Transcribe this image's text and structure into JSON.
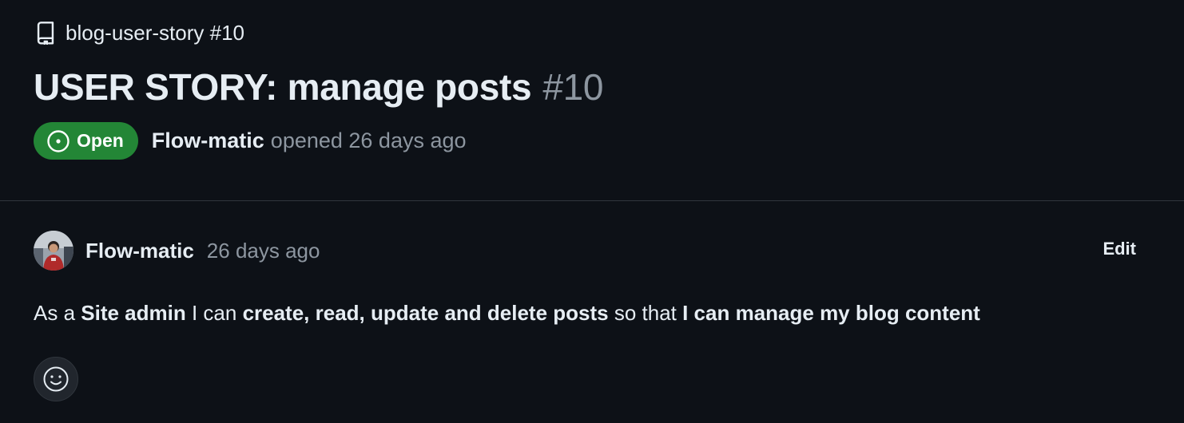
{
  "breadcrumb": {
    "icon": "repo-icon",
    "label": "blog-user-story #10"
  },
  "issue": {
    "title": "USER STORY: manage posts",
    "number": "#10",
    "state": {
      "label": "Open",
      "icon": "issue-opened-icon",
      "color": "#238636"
    },
    "author": "Flow-matic",
    "opened_text": "opened 26 days ago"
  },
  "comment": {
    "author": "Flow-matic",
    "time": "26 days ago",
    "edit_label": "Edit",
    "body": [
      {
        "text": "As a ",
        "bold": false
      },
      {
        "text": "Site admin",
        "bold": true
      },
      {
        "text": " I can ",
        "bold": false
      },
      {
        "text": "create, read, update and delete posts",
        "bold": true
      },
      {
        "text": " so that ",
        "bold": false
      },
      {
        "text": "I can manage my blog content",
        "bold": true
      }
    ],
    "reaction_icon": "smiley-icon"
  },
  "colors": {
    "background": "#0d1117",
    "text": "#e6edf3",
    "muted": "#8d96a0",
    "border": "#30363d"
  }
}
